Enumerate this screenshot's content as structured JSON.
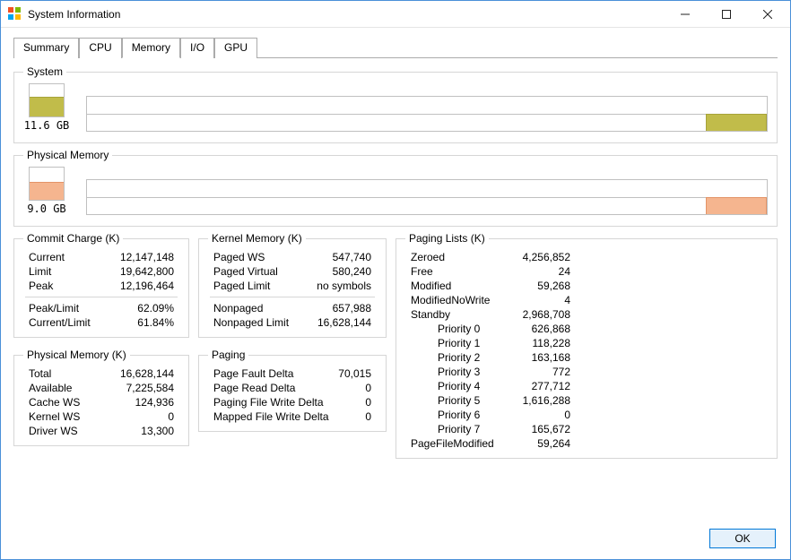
{
  "window": {
    "title": "System Information"
  },
  "tabs": {
    "summary": "Summary",
    "cpu": "CPU",
    "memory": "Memory",
    "io": "I/O",
    "gpu": "GPU"
  },
  "system_group": {
    "legend": "System",
    "value": "11.6 GB"
  },
  "physmem_group": {
    "legend": "Physical Memory",
    "value": "9.0 GB"
  },
  "commit": {
    "legend": "Commit Charge (K)",
    "current_l": "Current",
    "current_v": "12,147,148",
    "limit_l": "Limit",
    "limit_v": "19,642,800",
    "peak_l": "Peak",
    "peak_v": "12,196,464",
    "pl_l": "Peak/Limit",
    "pl_v": "62.09%",
    "cl_l": "Current/Limit",
    "cl_v": "61.84%"
  },
  "physmemk": {
    "legend": "Physical Memory (K)",
    "total_l": "Total",
    "total_v": "16,628,144",
    "avail_l": "Available",
    "avail_v": "7,225,584",
    "cache_l": "Cache WS",
    "cache_v": "124,936",
    "kernel_l": "Kernel WS",
    "kernel_v": "0",
    "driver_l": "Driver WS",
    "driver_v": "13,300"
  },
  "kernel": {
    "legend": "Kernel Memory (K)",
    "pws_l": "Paged WS",
    "pws_v": "547,740",
    "pv_l": "Paged Virtual",
    "pv_v": "580,240",
    "pl_l": "Paged Limit",
    "pl_v": "no symbols",
    "np_l": "Nonpaged",
    "np_v": "657,988",
    "npl_l": "Nonpaged Limit",
    "npl_v": "16,628,144"
  },
  "paging": {
    "legend": "Paging",
    "pfd_l": "Page Fault Delta",
    "pfd_v": "70,015",
    "prd_l": "Page Read Delta",
    "prd_v": "0",
    "pfw_l": "Paging File Write Delta",
    "pfw_v": "0",
    "mfw_l": "Mapped File Write Delta",
    "mfw_v": "0"
  },
  "paging_lists": {
    "legend": "Paging Lists (K)",
    "zeroed_l": "Zeroed",
    "zeroed_v": "4,256,852",
    "free_l": "Free",
    "free_v": "24",
    "mod_l": "Modified",
    "mod_v": "59,268",
    "mnw_l": "ModifiedNoWrite",
    "mnw_v": "4",
    "standby_l": "Standby",
    "standby_v": "2,968,708",
    "p0_l": "Priority 0",
    "p0_v": "626,868",
    "p1_l": "Priority 1",
    "p1_v": "118,228",
    "p2_l": "Priority 2",
    "p2_v": "163,168",
    "p3_l": "Priority 3",
    "p3_v": "772",
    "p4_l": "Priority 4",
    "p4_v": "277,712",
    "p5_l": "Priority 5",
    "p5_v": "1,616,288",
    "p6_l": "Priority 6",
    "p6_v": "0",
    "p7_l": "Priority 7",
    "p7_v": "165,672",
    "pfm_l": "PageFileModified",
    "pfm_v": "59,264"
  },
  "footer": {
    "ok": "OK"
  },
  "colors": {
    "system_fill": "#c1bc4a",
    "phys_fill": "#f5b58f"
  }
}
